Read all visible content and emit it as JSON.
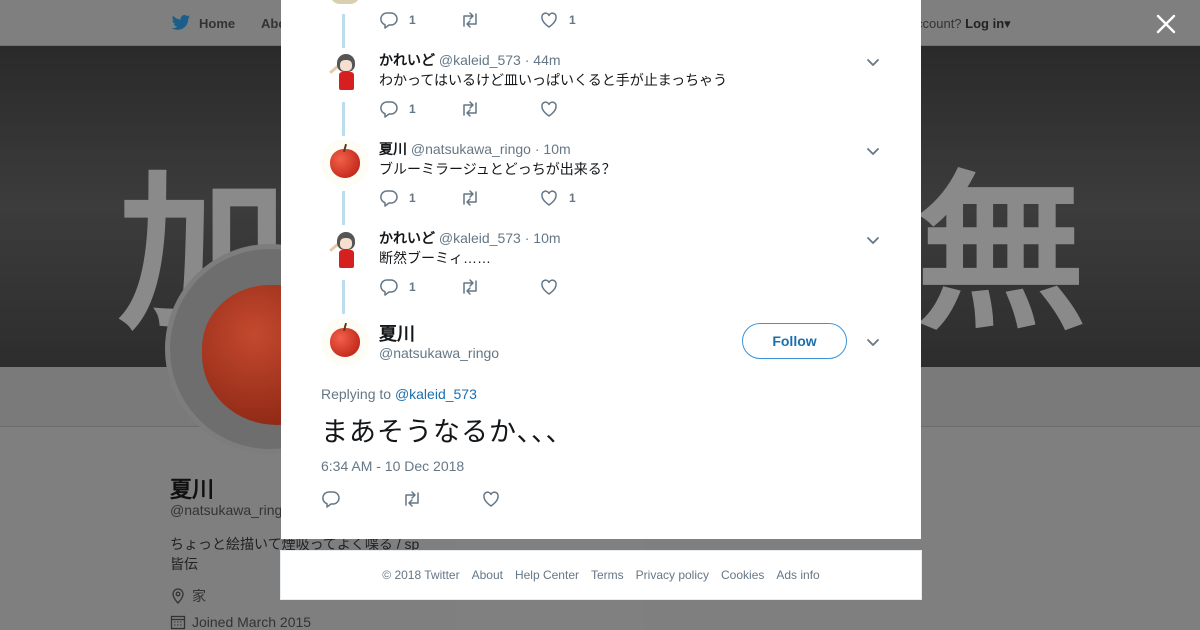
{
  "background": {
    "nav": {
      "home_label": "Home",
      "about_label": "Abo",
      "account_prompt": "ccount?",
      "login_label": "Log in"
    },
    "banner": {
      "left_glyph": "加",
      "right_glyph": "無"
    },
    "profile": {
      "name": "夏川",
      "handle": "@natsukawa_ringo",
      "bio_line1": "ちょっと絵描いて煙吸ってよく喋る / sp",
      "bio_line2": "皆伝",
      "location": "家",
      "joined": "Joined March 2015"
    },
    "ads_info": "Ads info"
  },
  "thread": [
    {
      "name": "",
      "handle": "",
      "time": "",
      "text": "",
      "avatar": "apple-avatar",
      "replies": "1",
      "retweets": "",
      "likes": "1"
    },
    {
      "name": "かれいど",
      "handle": "@kaleid_573",
      "time": "44m",
      "text": "わかってはいるけど皿いっぱいくると手が止まっちゃう",
      "avatar": "girl-avatar",
      "replies": "1",
      "retweets": "",
      "likes": ""
    },
    {
      "name": "夏川",
      "handle": "@natsukawa_ringo",
      "time": "10m",
      "text": "ブルーミラージュとどっちが出来る？",
      "avatar": "apple-avatar",
      "replies": "1",
      "retweets": "",
      "likes": "1"
    },
    {
      "name": "かれいど",
      "handle": "@kaleid_573",
      "time": "10m",
      "text": "断然ブーミィ……",
      "avatar": "girl-avatar",
      "replies": "1",
      "retweets": "",
      "likes": ""
    }
  ],
  "main_tweet": {
    "name": "夏川",
    "handle": "@natsukawa_ringo",
    "follow_label": "Follow",
    "replying_prefix": "Replying to",
    "replying_to": "@kaleid_573",
    "text": "まあそうなるか、、、",
    "timestamp": "6:34 AM - 10 Dec 2018"
  },
  "footer": {
    "links": [
      "© 2018 Twitter",
      "About",
      "Help Center",
      "Terms",
      "Privacy policy",
      "Cookies",
      "Ads info"
    ]
  },
  "colors": {
    "accent": "#1da1f2",
    "link": "#1b6fae",
    "muted": "#657786",
    "thread_line": "#bcdcf0",
    "overlay": "#7f7f7f"
  }
}
